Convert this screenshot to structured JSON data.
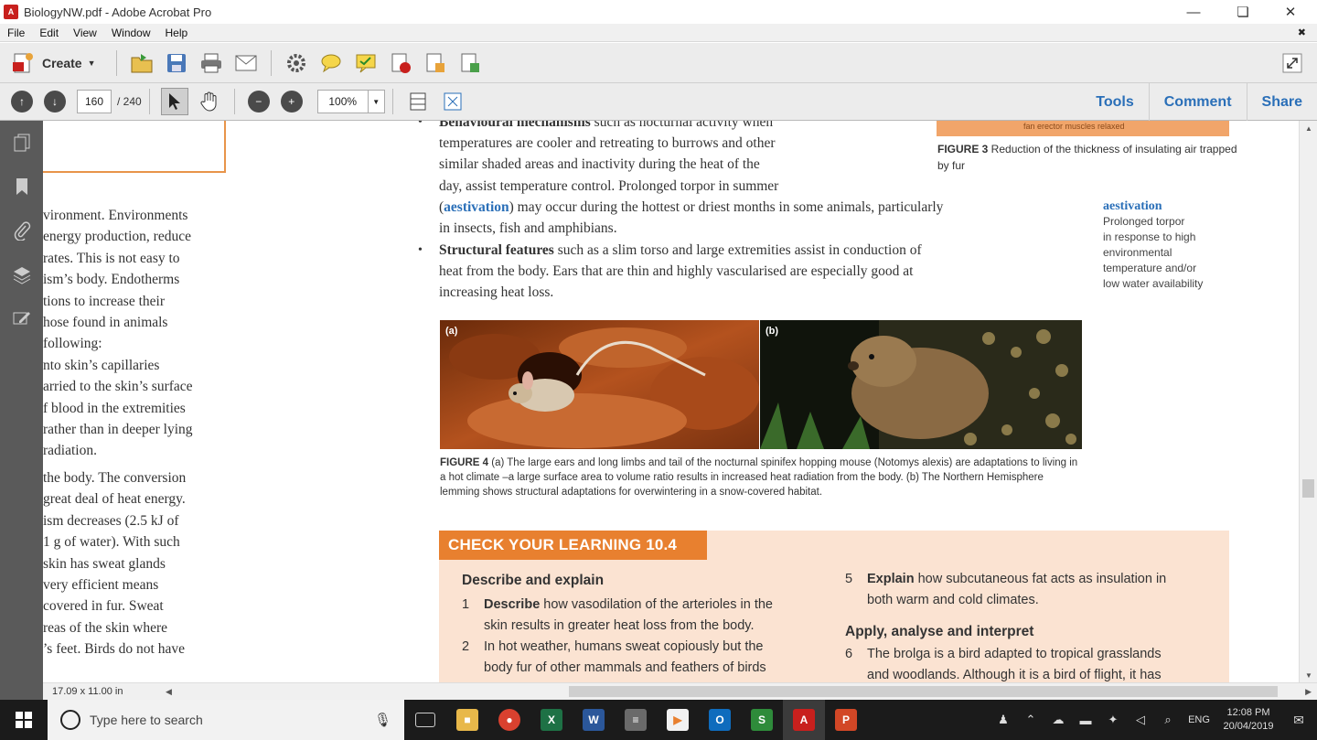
{
  "window": {
    "title": "BiologyNW.pdf - Adobe Acrobat Pro",
    "minimize": "—",
    "restore": "❏",
    "close": "✕"
  },
  "menu": {
    "items": [
      "File",
      "Edit",
      "View",
      "Window",
      "Help"
    ],
    "close_doc": "✖"
  },
  "toolbar": {
    "create_label": "Create",
    "create_caret": "▼",
    "page_current": "160",
    "page_total": "/ 240",
    "zoom": "100%",
    "zoom_caret": "▼",
    "prev_glyph": "↑",
    "next_glyph": "↓",
    "zoom_out_glyph": "−",
    "zoom_in_glyph": "+",
    "tabs": [
      "Tools",
      "Comment",
      "Share"
    ]
  },
  "nav_icons": [
    "pages-icon",
    "bookmarks-icon",
    "attachments-icon",
    "layers-icon",
    "signatures-icon"
  ],
  "doc": {
    "left_col_lines": [
      "vironment. Environments",
      " energy production, reduce",
      "rates. This is not easy to",
      "ism’s body. Endotherms",
      "tions to increase their",
      "hose found in animals",
      " following:",
      "nto skin’s capillaries",
      "arried to the skin’s surface",
      "f blood in the extremities",
      "rather than in deeper lying",
      "radiation.",
      "the body. The conversion",
      " great deal of heat energy.",
      "ism decreases (2.5 kJ of",
      " 1 g of water). With such",
      " skin has sweat glands",
      " very efficient means",
      " covered in fur. Sweat",
      "reas of the skin where",
      "’s feet. Birds do not have"
    ],
    "bullet1": {
      "term": "Behavioural mechanisms",
      "first_rest": " such as nocturnal activity when",
      "lines": [
        "temperatures are cooler and retreating to burrows and other",
        "similar shaded areas and inactivity during the heat of the",
        "day, assist temperature control. Prolonged torpor in summer"
      ],
      "aest_open": "(",
      "aest_term": "aestivation",
      "aest_rest": ") may occur during the hottest or driest months in some animals, particularly",
      "last_line": "in insects, fish and amphibians."
    },
    "bullet2": {
      "term": "Structural features",
      "first_rest": " such as a slim torso and large extremities assist in conduction of",
      "lines": [
        "heat from the body. Ears that are thin and highly vascularised are especially good at",
        "increasing heat loss."
      ]
    },
    "bullet_glyph": "•",
    "fig3_bar_text": "fan erector muscles relaxed",
    "fig3_label": "FIGURE 3",
    "fig3_text": " Reduction of the thickness of insulating air trapped by fur",
    "glossary": {
      "term": "aestivation",
      "lines": [
        "Prolonged torpor",
        "in response to high",
        "environmental",
        "temperature and/or",
        "low water availability"
      ]
    },
    "photo_a_label": "(a)",
    "photo_b_label": "(b)",
    "fig4_label": "FIGURE 4",
    "fig4_text": " (a) The large ears and long limbs and tail of the nocturnal spinifex hopping mouse (Notomys alexis) are adaptations to living in a hot climate –a large surface area to volume ratio results in increased heat radiation from the body. (b) The Northern Hemisphere lemming shows structural adaptations for overwintering in a snow-covered habitat.",
    "check": {
      "banner": "CHECK YOUR LEARNING 10.4",
      "h1": "Describe and explain",
      "q1_num": "1",
      "q1_bold": "Describe",
      "q1_l1": " how vasodilation of the arterioles in the",
      "q1_l2": "skin results in greater heat loss from the body.",
      "q2_num": "2",
      "q2_l1": "In hot weather, humans sweat copiously but the",
      "q2_l2": "body fur of other mammals and feathers of birds",
      "q5_num": "5",
      "q5_bold": "Explain",
      "q5_l1": " how subcutaneous fat acts as insulation in",
      "q5_l2": "both warm and cold climates.",
      "h2": "Apply, analyse and interpret",
      "q6_num": "6",
      "q6_l1": "The brolga is a bird adapted to tropical grasslands",
      "q6_l2": "and woodlands. Although it is a bird of flight, it has"
    }
  },
  "status": {
    "page_size": "17.09 x 11.00 in",
    "scroll_left": "◀",
    "scroll_right": "▶",
    "scroll_up": "▲",
    "scroll_down": "▼"
  },
  "taskbar": {
    "search_placeholder": "Type here to search",
    "mic_glyph": "🎙",
    "apps": [
      {
        "name": "task-view",
        "label": "▭",
        "color": "#1b1b1b"
      },
      {
        "name": "file-explorer",
        "label": "■",
        "color": "#e8b84a"
      },
      {
        "name": "chrome",
        "label": "●",
        "color": "#d9412f"
      },
      {
        "name": "excel",
        "label": "X",
        "color": "#1e7145"
      },
      {
        "name": "word",
        "label": "W",
        "color": "#2b579a"
      },
      {
        "name": "calculator",
        "label": "≡",
        "color": "#6a6a6a"
      },
      {
        "name": "media-player",
        "label": "▶",
        "color": "#f2f2f2"
      },
      {
        "name": "outlook",
        "label": "O",
        "color": "#0f6cbd"
      },
      {
        "name": "sway",
        "label": "S",
        "color": "#2e8b3a"
      },
      {
        "name": "acrobat",
        "label": "A",
        "color": "#c8201d"
      },
      {
        "name": "powerpoint",
        "label": "P",
        "color": "#d24726"
      }
    ],
    "tray_glyphs": [
      "♟",
      "⌃",
      "☁",
      "▬",
      "✦",
      "◁",
      "⌕"
    ],
    "lang": "ENG",
    "time": "12:08 PM",
    "date": "20/04/2019",
    "notif_glyph": "✉"
  },
  "colors": {
    "accent_blue": "#2a6fb8",
    "orange_banner": "#e8802f",
    "panel_peach": "#fbe3d2",
    "nav_gray": "#5a5a5a",
    "taskbar": "#1b1b1b"
  }
}
